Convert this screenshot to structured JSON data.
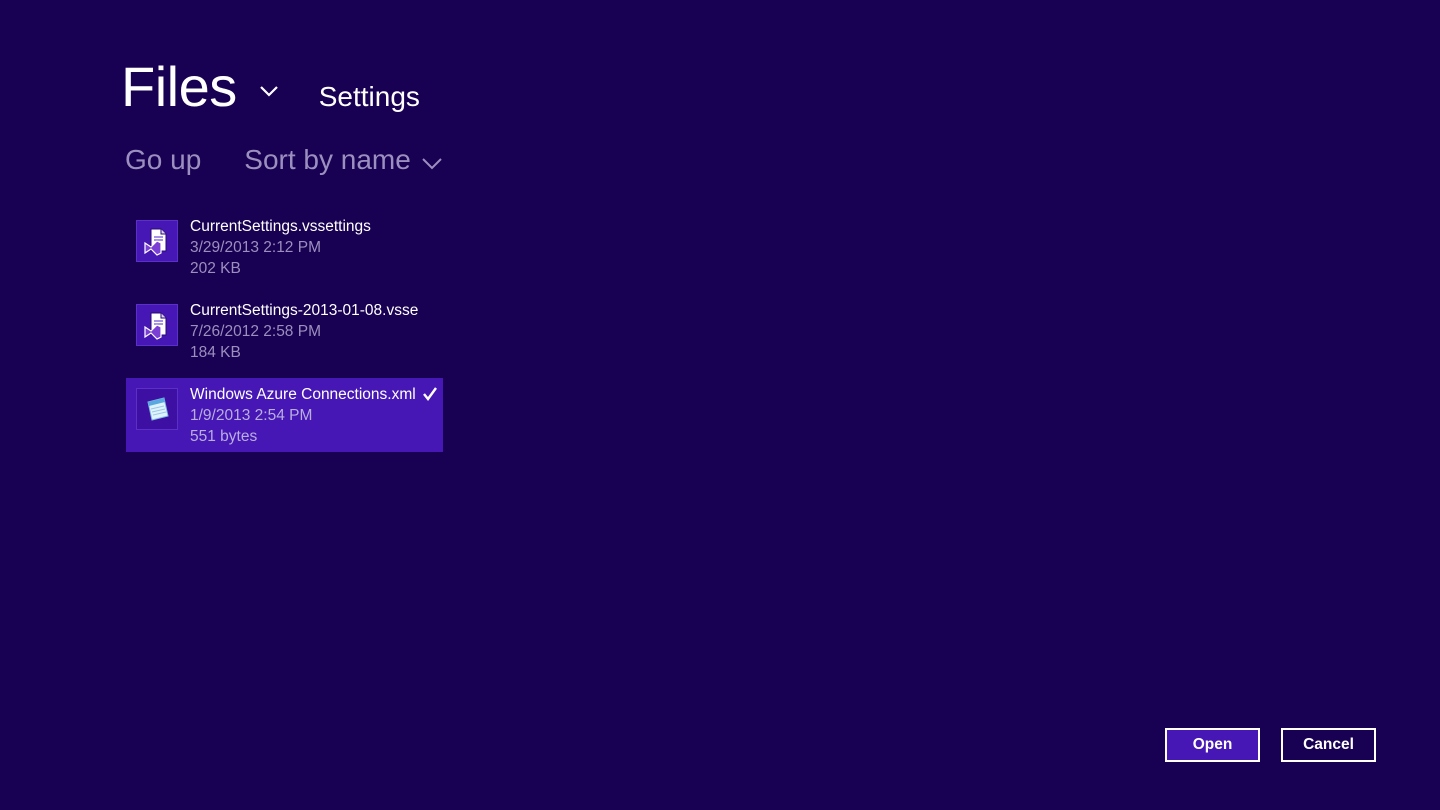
{
  "header": {
    "title": "Files",
    "location": "Settings"
  },
  "commands": {
    "go_up": "Go up",
    "sort": "Sort by name"
  },
  "files": [
    {
      "name": "CurrentSettings.vssettings",
      "date": "3/29/2013 2:12 PM",
      "size": "202 KB",
      "icon": "vs-settings-file-icon",
      "selected": false
    },
    {
      "name": "CurrentSettings-2013-01-08.vsset...",
      "date": "7/26/2012 2:58 PM",
      "size": "184 KB",
      "icon": "vs-settings-file-icon",
      "selected": false
    },
    {
      "name": "Windows Azure Connections.xml",
      "date": "1/9/2013 2:54 PM",
      "size": "551 bytes",
      "icon": "notepad-file-icon",
      "selected": true
    }
  ],
  "buttons": {
    "open": "Open",
    "cancel": "Cancel"
  },
  "colors": {
    "background": "#180052",
    "accent": "#4617b4",
    "secondary_text": "#9b8fbf"
  }
}
